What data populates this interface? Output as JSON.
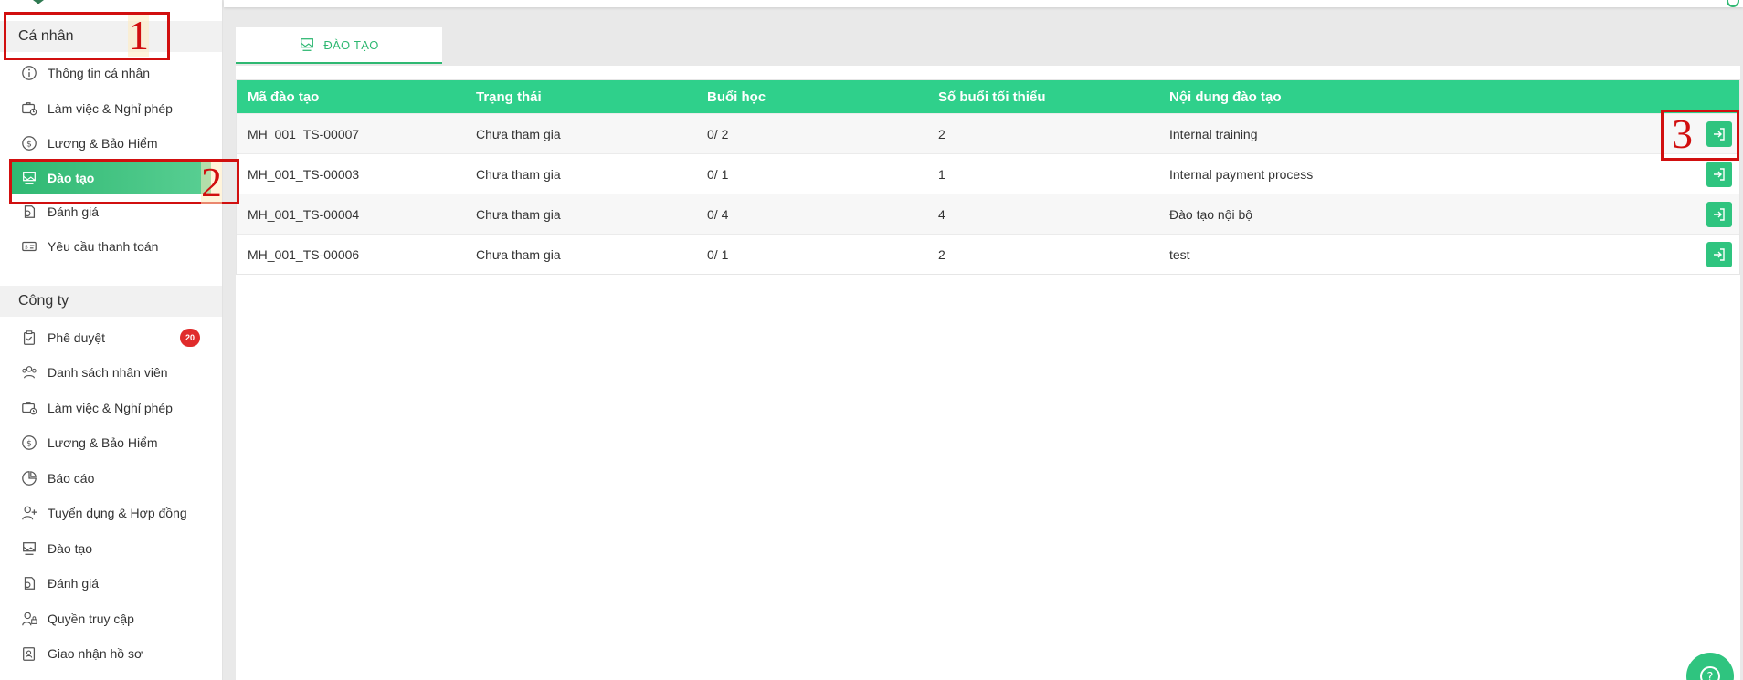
{
  "sidebar": {
    "personal_title": "Cá nhân",
    "personal_items": [
      {
        "label": "Thông tin cá nhân",
        "icon": "info-icon"
      },
      {
        "label": "Làm việc & Nghỉ phép",
        "icon": "work-leave-icon"
      },
      {
        "label": "Lương & Bảo Hiểm",
        "icon": "dollar-icon"
      },
      {
        "label": "Đào tạo",
        "icon": "training-icon",
        "active": true
      },
      {
        "label": "Đánh giá",
        "icon": "evaluation-icon"
      },
      {
        "label": "Yêu cầu thanh toán",
        "icon": "payment-request-icon"
      }
    ],
    "company_title": "Công ty",
    "company_items": [
      {
        "label": "Phê duyệt",
        "icon": "approval-icon",
        "badge": "20"
      },
      {
        "label": "Danh sách nhân viên",
        "icon": "employees-icon"
      },
      {
        "label": "Làm việc & Nghỉ phép",
        "icon": "work-leave-icon"
      },
      {
        "label": "Lương & Bảo Hiểm",
        "icon": "dollar-icon"
      },
      {
        "label": "Báo cáo",
        "icon": "report-icon"
      },
      {
        "label": "Tuyển dụng & Hợp đồng",
        "icon": "recruit-icon"
      },
      {
        "label": "Đào tạo",
        "icon": "training-icon"
      },
      {
        "label": "Đánh giá",
        "icon": "evaluation-icon"
      },
      {
        "label": "Quyền truy cập",
        "icon": "access-icon"
      },
      {
        "label": "Giao nhận hồ sơ",
        "icon": "documents-icon"
      }
    ]
  },
  "tab": {
    "label": "ĐÀO TẠO",
    "icon": "training-icon"
  },
  "table": {
    "headers": [
      "Mã đào tạo",
      "Trạng thái",
      "Buổi học",
      "Số buổi tối thiểu",
      "Nội dung đào tạo"
    ],
    "rows": [
      [
        "MH_001_TS-00007",
        "Chưa tham gia",
        "0/ 2",
        "2",
        "Internal training"
      ],
      [
        "MH_001_TS-00003",
        "Chưa tham gia",
        "0/ 1",
        "1",
        "Internal payment process"
      ],
      [
        "MH_001_TS-00004",
        "Chưa tham gia",
        "0/ 4",
        "4",
        "Đào tạo nội bộ"
      ],
      [
        "MH_001_TS-00006",
        "Chưa tham gia",
        "0/ 1",
        "2",
        "test"
      ]
    ],
    "action_icon": "enter-icon"
  },
  "annotations": [
    "1",
    "2",
    "3"
  ],
  "colors": {
    "accent": "#2fb872",
    "header": "#2fd08b",
    "badge": "#e02b2b",
    "annotation": "#d10f0f"
  }
}
